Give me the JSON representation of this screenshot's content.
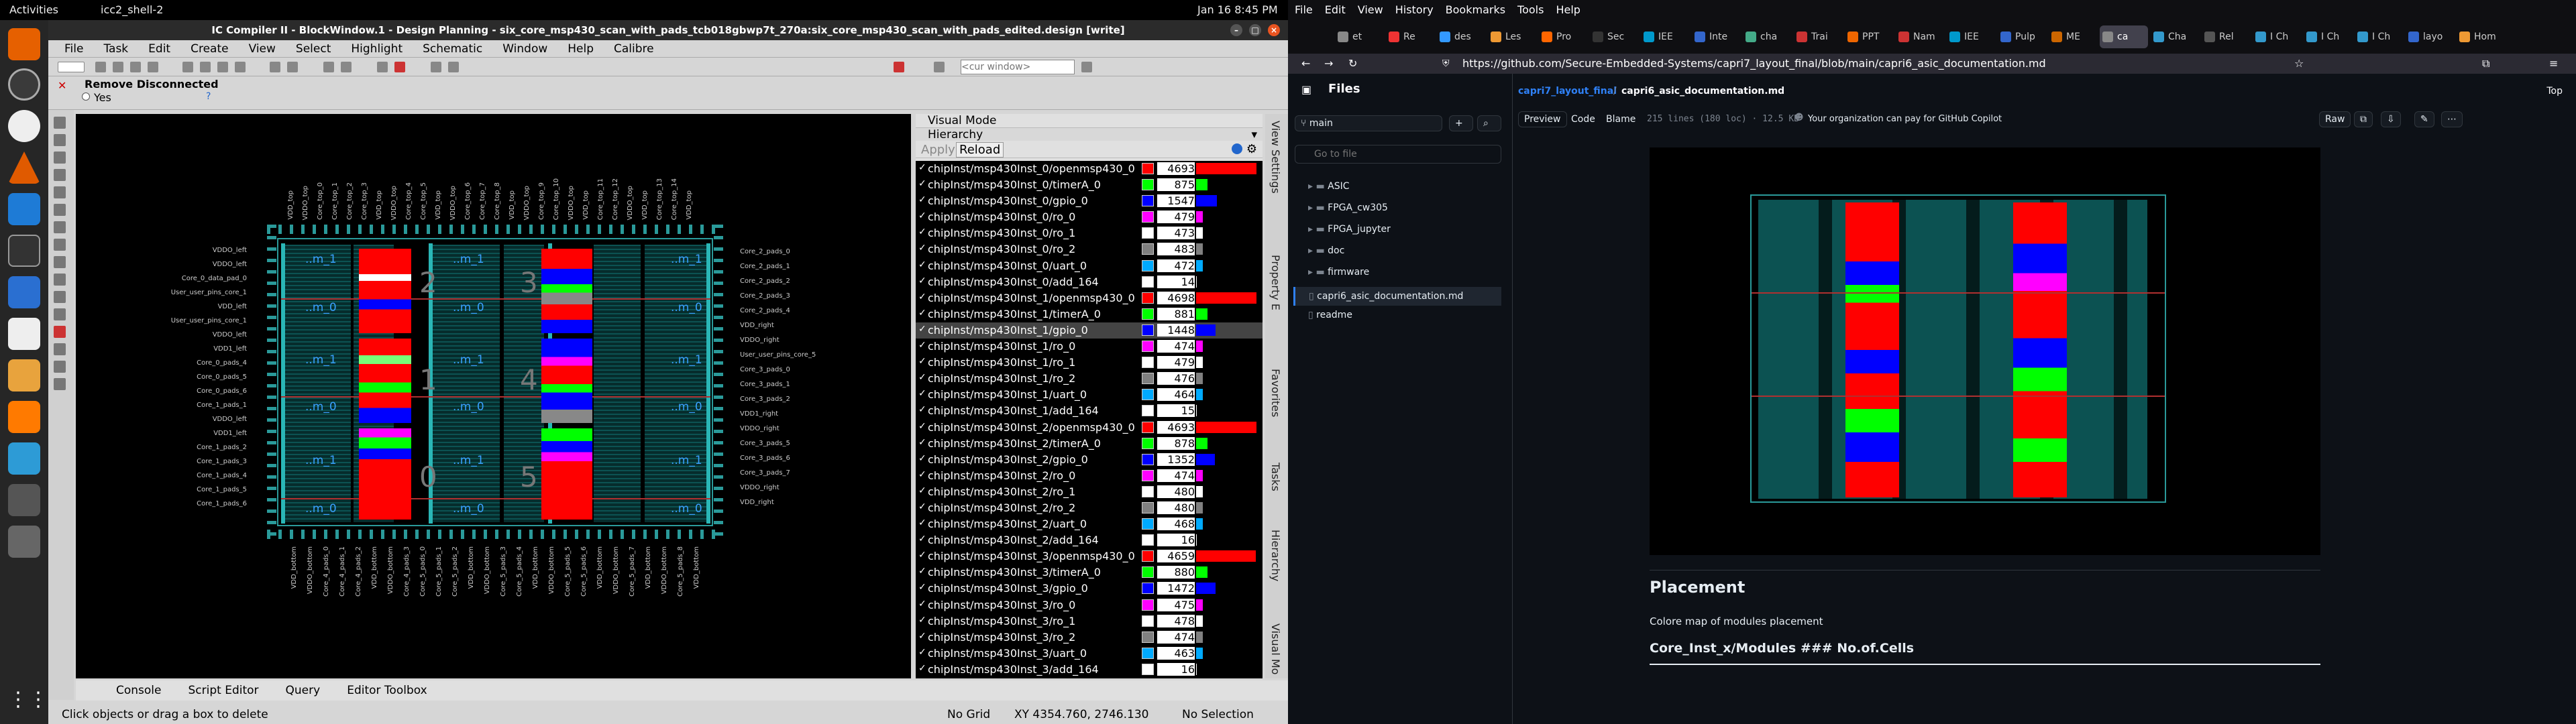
{
  "topbar": {
    "activities": "Activities",
    "app": "icc2_shell-2",
    "clock": "Jan 16  8:45 PM"
  },
  "icc": {
    "title": "IC Compiler II - BlockWindow.1 - Design Planning - six_core_msp430_scan_with_pads_tcb018gbwp7t_270a:six_core_msp430_scan_with_pads_edited.design [write]",
    "menu": [
      "File",
      "Task",
      "Edit",
      "Create",
      "View",
      "Select",
      "Highlight",
      "Schematic",
      "Window",
      "Help",
      "Calibre"
    ],
    "cur_window_placeholder": "<cur window>",
    "remove_label": "Remove Disconnected",
    "yes_label": "Yes",
    "canvas": {
      "macro_labels": [
        "..m_1",
        "..m_0"
      ],
      "digits": [
        "2",
        "3",
        "1",
        "4",
        "0",
        "5"
      ],
      "left_pins": [
        "VDDO_left",
        "VDDO_left",
        "Core_0_data_pad_0",
        "User_user_pins_core_1",
        "VDD_left",
        "User_user_pins_core_1",
        "VDDO_left",
        "VDD1_left",
        "Core_0_pads_4",
        "Core_0_pads_5",
        "Core_0_pads_6",
        "Core_1_pads_1",
        "VDDO_left",
        "VDD1_left",
        "Core_1_pads_2",
        "Core_1_pads_3",
        "Core_1_pads_4",
        "Core_1_pads_5",
        "Core_1_pads_6"
      ],
      "right_pins": [
        "Core_2_pads_0",
        "Core_2_pads_1",
        "Core_2_pads_2",
        "Core_2_pads_3",
        "Core_2_pads_4",
        "VDD_right",
        "VDDO_right",
        "User_user_pins_core_5",
        "Core_3_pads_0",
        "Core_3_pads_1",
        "Core_3_pads_2",
        "VDD1_right",
        "VDDO_right",
        "Core_3_pads_5",
        "Core_3_pads_6",
        "Core_3_pads_7",
        "VDDO_right",
        "VDD_right"
      ],
      "top_pins": [
        "VDD_top",
        "VDDO_top",
        "Core_top_0",
        "Core_top_1",
        "Core_top_2",
        "Core_top_3",
        "VDD_top",
        "VDDO_top",
        "Core_top_4",
        "Core_top_5",
        "VDD_top",
        "VDDO_top",
        "Core_top_6",
        "Core_top_7",
        "Core_top_8",
        "VDD_top",
        "VDDO_top",
        "Core_top_9",
        "Core_top_10",
        "VDDO_top",
        "VDD_top",
        "Core_top_11",
        "Core_top_12",
        "VDDO_top",
        "VDD_top",
        "Core_top_13",
        "Core_top_14",
        "VDD_top"
      ],
      "bottom_pins": [
        "VDD_bottom",
        "VDDO_bottom",
        "Core_4_pads_0",
        "Core_4_pads_1",
        "Core_4_pads_2",
        "VDD_bottom",
        "VDDO_bottom",
        "Core_4_pads_3",
        "Core_5_pads_0",
        "Core_5_pads_1",
        "Core_5_pads_2",
        "VDD_bottom",
        "VDDO_bottom",
        "Core_5_pads_3",
        "Core_5_pads_4",
        "VDD_bottom",
        "VDDO_bottom",
        "Core_5_pads_5",
        "Core_5_pads_6",
        "VDD_bottom",
        "VDDO_bottom",
        "Core_5_pads_7",
        "VDD_bottom",
        "VDDO_bottom",
        "Core_5_pads_8",
        "VDD_bottom"
      ]
    },
    "visual_mode": {
      "title": "Visual Mode",
      "hierarchy": "Hierarchy",
      "apply": "Apply",
      "reload": "Reload",
      "rows": [
        {
          "name": "chipInst/msp430Inst_0/openmsp430_0",
          "count": "4693",
          "color": "#ff0000",
          "fill": 0.95
        },
        {
          "name": "chipInst/msp430Inst_0/timerA_0",
          "count": "875",
          "color": "#00ff00",
          "fill": 0.18
        },
        {
          "name": "chipInst/msp430Inst_0/gpio_0",
          "count": "1547",
          "color": "#0000ff",
          "fill": 0.33
        },
        {
          "name": "chipInst/msp430Inst_0/ro_0",
          "count": "479",
          "color": "#ff00ff",
          "fill": 0.1
        },
        {
          "name": "chipInst/msp430Inst_0/ro_1",
          "count": "473",
          "color": "#ffffff",
          "fill": 0.1
        },
        {
          "name": "chipInst/msp430Inst_0/ro_2",
          "count": "483",
          "color": "#808080",
          "fill": 0.1
        },
        {
          "name": "chipInst/msp430Inst_0/uart_0",
          "count": "472",
          "color": "#00aaff",
          "fill": 0.1
        },
        {
          "name": "chipInst/msp430Inst_0/add_164",
          "count": "14",
          "color": "#ffffff",
          "fill": 0.01
        },
        {
          "name": "chipInst/msp430Inst_1/openmsp430_0",
          "count": "4698",
          "color": "#ff0000",
          "fill": 0.95
        },
        {
          "name": "chipInst/msp430Inst_1/timerA_0",
          "count": "881",
          "color": "#00ff00",
          "fill": 0.18
        },
        {
          "name": "chipInst/msp430Inst_1/gpio_0",
          "count": "1448",
          "color": "#0000ff",
          "fill": 0.31
        },
        {
          "name": "chipInst/msp430Inst_1/ro_0",
          "count": "474",
          "color": "#ff00ff",
          "fill": 0.1
        },
        {
          "name": "chipInst/msp430Inst_1/ro_1",
          "count": "479",
          "color": "#ffffff",
          "fill": 0.1
        },
        {
          "name": "chipInst/msp430Inst_1/ro_2",
          "count": "476",
          "color": "#808080",
          "fill": 0.1
        },
        {
          "name": "chipInst/msp430Inst_1/uart_0",
          "count": "464",
          "color": "#00aaff",
          "fill": 0.1
        },
        {
          "name": "chipInst/msp430Inst_1/add_164",
          "count": "15",
          "color": "#ffffff",
          "fill": 0.01
        },
        {
          "name": "chipInst/msp430Inst_2/openmsp430_0",
          "count": "4693",
          "color": "#ff0000",
          "fill": 0.95
        },
        {
          "name": "chipInst/msp430Inst_2/timerA_0",
          "count": "878",
          "color": "#00ff00",
          "fill": 0.18
        },
        {
          "name": "chipInst/msp430Inst_2/gpio_0",
          "count": "1352",
          "color": "#0000ff",
          "fill": 0.29
        },
        {
          "name": "chipInst/msp430Inst_2/ro_0",
          "count": "474",
          "color": "#ff00ff",
          "fill": 0.1
        },
        {
          "name": "chipInst/msp430Inst_2/ro_1",
          "count": "480",
          "color": "#ffffff",
          "fill": 0.1
        },
        {
          "name": "chipInst/msp430Inst_2/ro_2",
          "count": "480",
          "color": "#808080",
          "fill": 0.1
        },
        {
          "name": "chipInst/msp430Inst_2/uart_0",
          "count": "468",
          "color": "#00aaff",
          "fill": 0.1
        },
        {
          "name": "chipInst/msp430Inst_2/add_164",
          "count": "16",
          "color": "#ffffff",
          "fill": 0.01
        },
        {
          "name": "chipInst/msp430Inst_3/openmsp430_0",
          "count": "4659",
          "color": "#ff0000",
          "fill": 0.94
        },
        {
          "name": "chipInst/msp430Inst_3/timerA_0",
          "count": "880",
          "color": "#00ff00",
          "fill": 0.18
        },
        {
          "name": "chipInst/msp430Inst_3/gpio_0",
          "count": "1472",
          "color": "#0000ff",
          "fill": 0.31
        },
        {
          "name": "chipInst/msp430Inst_3/ro_0",
          "count": "475",
          "color": "#ff00ff",
          "fill": 0.1
        },
        {
          "name": "chipInst/msp430Inst_3/ro_1",
          "count": "478",
          "color": "#ffffff",
          "fill": 0.1
        },
        {
          "name": "chipInst/msp430Inst_3/ro_2",
          "count": "474",
          "color": "#808080",
          "fill": 0.1
        },
        {
          "name": "chipInst/msp430Inst_3/uart_0",
          "count": "463",
          "color": "#00aaff",
          "fill": 0.1
        },
        {
          "name": "chipInst/msp430Inst_3/add_164",
          "count": "16",
          "color": "#ffffff",
          "fill": 0.01
        }
      ],
      "selected_row": 10
    },
    "side_tabs": [
      "View Settings",
      "Property E",
      "Favorites",
      "Tasks",
      "Hierarchy",
      "Visual Mo"
    ],
    "bottom_tabs": [
      "Console",
      "Script Editor",
      "Query",
      "Editor Toolbox"
    ],
    "status": {
      "hint": "Click objects or drag a box to delete",
      "grid": "No Grid",
      "coords": "XY 4354.760, 2746.130",
      "selection": "No Selection"
    }
  },
  "firefox": {
    "menu": [
      "File",
      "Edit",
      "View",
      "History",
      "Bookmarks",
      "Tools",
      "Help"
    ],
    "tabs": [
      "et",
      "Re",
      "des",
      "Les",
      "Pro",
      "Sec",
      "IEE",
      "Inte",
      "cha",
      "Trai",
      "PPT",
      "Nam",
      "IEE",
      "Pulp",
      "ME",
      "ca",
      "Cha",
      "Rel",
      "I Ch",
      "I Ch",
      "I Ch",
      "layo",
      "Hom"
    ],
    "active_tab": 15,
    "url": "https://github.com/Secure-Embedded-Systems/capri7_layout_final/blob/main/capri6_asic_documentation.md",
    "github": {
      "files_title": "Files",
      "branch": "main",
      "goto_placeholder": "Go to file",
      "tree": [
        "ASIC",
        "FPGA_cw305",
        "FPGA_jupyter",
        "doc",
        "firmware",
        "capri6_asic_documentation.md",
        "readme"
      ],
      "breadcrumb_repo": "capri7_layout_final",
      "breadcrumb_file": "capri6_asic_documentation.md",
      "top_label": "Top",
      "tabs": [
        "Preview",
        "Code",
        "Blame"
      ],
      "file_meta": "215 lines (180 loc) · 12.5 KB",
      "copilot": "Your organization can pay for GitHub Copilot",
      "raw": "Raw",
      "heading": "Placement",
      "paragraph": "Colore map of modules placement",
      "subheading": "Core_Inst_x/Modules ### No.of.Cells"
    }
  }
}
